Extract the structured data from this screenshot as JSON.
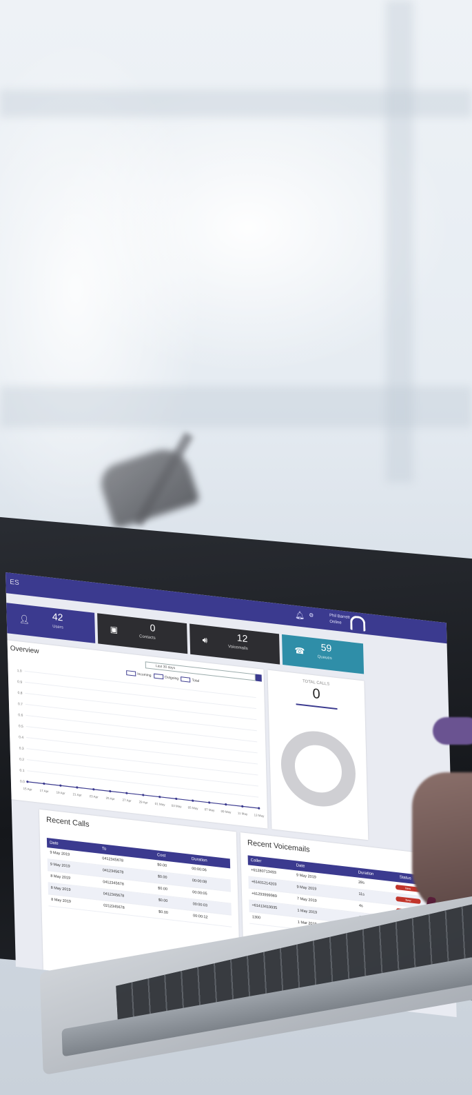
{
  "app": {
    "brand": "ES"
  },
  "user": {
    "name": "Phil Barrett",
    "status": "Online"
  },
  "colors": {
    "primary": "#3b3a8f",
    "teal": "#2f8ea8",
    "dark": "#2d2d31",
    "danger": "#c2352b"
  },
  "stats": [
    {
      "value": "42",
      "label": "Users",
      "icon": "user-icon",
      "color": "#3b3a8f"
    },
    {
      "value": "0",
      "label": "Contacts",
      "icon": "contacts-book-icon",
      "color": "#2d2d31"
    },
    {
      "value": "12",
      "label": "Voicemails",
      "icon": "speaker-icon",
      "color": "#2d2d31"
    },
    {
      "value": "59",
      "label": "Queues",
      "icon": "phone-icon",
      "color": "#2f8ea8"
    }
  ],
  "overview": {
    "title": "Overview",
    "date_range": "Last 30 days",
    "legend": [
      "Incoming",
      "Outgoing",
      "Total"
    ]
  },
  "chart_data": {
    "type": "line",
    "y_ticks": [
      "0.0",
      "0.1",
      "0.2",
      "0.3",
      "0.4",
      "0.5",
      "0.6",
      "0.7",
      "0.8",
      "0.9",
      "1.0"
    ],
    "x_ticks": [
      "15 Apr",
      "17 Apr",
      "19 Apr",
      "21 Apr",
      "23 Apr",
      "25 Apr",
      "27 Apr",
      "29 Apr",
      "01 May",
      "03 May",
      "05 May",
      "07 May",
      "09 May",
      "11 May",
      "13 May"
    ],
    "series": [
      {
        "values": [
          0,
          0,
          0,
          0,
          0,
          0,
          0,
          0,
          0,
          0,
          0,
          0,
          0,
          0,
          0
        ]
      }
    ],
    "ylim": [
      0,
      1
    ]
  },
  "total_calls": {
    "label": "TOTAL CALLS",
    "value": "0"
  },
  "recent_calls": {
    "title": "Recent Calls",
    "columns": [
      "Date",
      "To",
      "Cost",
      "Duration"
    ],
    "rows": [
      [
        "9 May 2019",
        "0412345678",
        "$0.00",
        "00:00:06"
      ],
      [
        "9 May 2019",
        "0412345678",
        "$0.00",
        "00:00:08"
      ],
      [
        "8 May 2019",
        "0412345678",
        "$0.00",
        "00:00:05"
      ],
      [
        "8 May 2019",
        "0412345678",
        "$0.00",
        "00:00:03"
      ],
      [
        "8 May 2019",
        "0212345678",
        "$0.00",
        "00:00:12"
      ]
    ]
  },
  "recent_voicemails": {
    "title": "Recent Voicemails",
    "columns": [
      "Caller",
      "Date",
      "Duration",
      "Status"
    ],
    "rows": [
      [
        "+61280713493",
        "9 May 2019",
        "28s",
        "New"
      ],
      [
        "+61401214203",
        "9 May 2019",
        "11s",
        "New"
      ],
      [
        "+61293999989",
        "7 May 2019",
        "4s",
        "New"
      ],
      [
        "+61413419935",
        "1 May 2019",
        "28s",
        "Old"
      ],
      [
        "1300",
        "1 Mar 2019",
        "28s",
        "New"
      ]
    ]
  }
}
